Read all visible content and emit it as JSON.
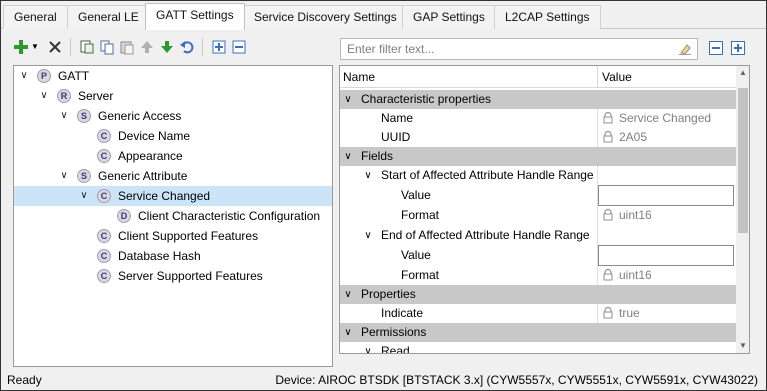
{
  "tabs": [
    {
      "label": "General"
    },
    {
      "label": "General LE"
    },
    {
      "label": "GATT Settings"
    },
    {
      "label": "Service Discovery Settings"
    },
    {
      "label": "GAP Settings"
    },
    {
      "label": "L2CAP Settings"
    }
  ],
  "filter": {
    "placeholder": "Enter filter text..."
  },
  "tree": {
    "items": [
      {
        "label": "GATT",
        "badge": "P",
        "expanded": true
      },
      {
        "label": "Server",
        "badge": "R",
        "expanded": true
      },
      {
        "label": "Generic Access",
        "badge": "S",
        "expanded": true
      },
      {
        "label": "Device Name",
        "badge": "C"
      },
      {
        "label": "Appearance",
        "badge": "C"
      },
      {
        "label": "Generic Attribute",
        "badge": "S",
        "expanded": true
      },
      {
        "label": "Service Changed",
        "badge": "C",
        "expanded": true,
        "selected": true
      },
      {
        "label": "Client Characteristic Configuration",
        "badge": "D"
      },
      {
        "label": "Client Supported Features",
        "badge": "C"
      },
      {
        "label": "Database Hash",
        "badge": "C"
      },
      {
        "label": "Server Supported Features",
        "badge": "C"
      }
    ]
  },
  "grid": {
    "header": {
      "name": "Name",
      "value": "Value"
    },
    "rows": [
      {
        "name": "Characteristic properties",
        "type": "category"
      },
      {
        "name": "Name",
        "value": "Service Changed",
        "locked": true
      },
      {
        "name": "UUID",
        "value": "2A05",
        "locked": true
      },
      {
        "name": "Fields",
        "type": "category"
      },
      {
        "name": "Start of Affected Attribute Handle Range",
        "type": "subcategory"
      },
      {
        "name": "Value",
        "value": "",
        "editable": true
      },
      {
        "name": "Format",
        "value": "uint16",
        "locked": true
      },
      {
        "name": "End of Affected Attribute Handle Range",
        "type": "subcategory"
      },
      {
        "name": "Value",
        "value": "",
        "editable": true
      },
      {
        "name": "Format",
        "value": "uint16",
        "locked": true
      },
      {
        "name": "Properties",
        "type": "category"
      },
      {
        "name": "Indicate",
        "value": "true",
        "locked": true
      },
      {
        "name": "Permissions",
        "type": "category"
      },
      {
        "name": "Read",
        "type": "subcategory"
      }
    ]
  },
  "status": {
    "left": "Ready",
    "right": "Device: AIROC BTSDK [BTSTACK 3.x] (CYW5557x, CYW5551x, CYW5591x, CYW43022)"
  },
  "colors": {
    "selection": "#cce4f7",
    "category": "#c8c8c8",
    "accent": "#3a6fc4"
  }
}
